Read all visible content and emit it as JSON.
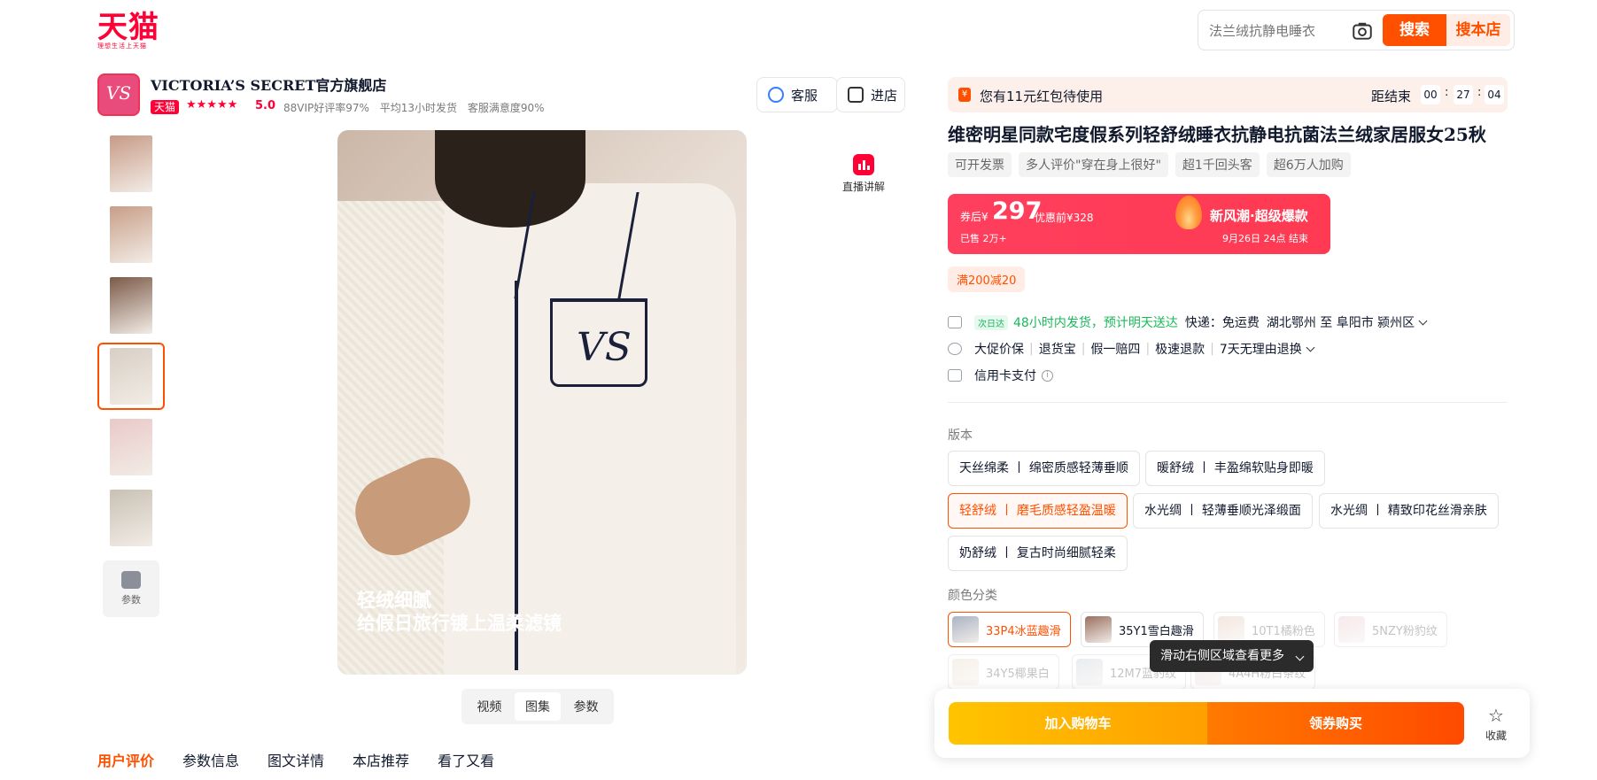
{
  "header": {
    "logo": "天猫",
    "logo_sub": "理想生活上天猫",
    "search_placeholder": "法兰绒抗静电睡衣",
    "search_button": "搜索",
    "search_store_button": "搜本店"
  },
  "shop": {
    "logo_text": "VS",
    "name": "VICTORIA’S SECRET官方旗舰店",
    "badge": "天猫",
    "stars": "★★★★★",
    "rating": "5.0",
    "stats": [
      "88VIP好评率97%",
      "平均13小时发货",
      "客服满意度90%"
    ],
    "service_button": "客服",
    "enter_button": "进店"
  },
  "gallery": {
    "caption_line1": "轻绒细腻",
    "caption_line2": "给假日旅行镀上温柔滤镜",
    "live_explain": "直播讲解",
    "params_thumb": "参数",
    "view_tabs": [
      "视频",
      "图集",
      "参数"
    ],
    "active_tab": "图集",
    "thumb_colors": [
      "#c79a86",
      "#c89e88",
      "#7b5a48",
      "#d8cfc4",
      "#e9c9c8",
      "#c9c1b4"
    ],
    "active_thumb_index": 3
  },
  "bottom_nav": [
    "用户评价",
    "参数信息",
    "图文详情",
    "本店推荐",
    "看了又看"
  ],
  "product": {
    "red_packet": "您有11元红包待使用",
    "countdown_label": "距结束",
    "countdown": [
      "00",
      "27",
      "04"
    ],
    "title": "维密明星同款宅度假系列轻舒绒睡衣抗静电抗菌法兰绒家居服女25秋",
    "tags": [
      "可开发票",
      "多人评价\"穿在身上很好\"",
      "超1千回头客",
      "超6万人加购"
    ],
    "price_prefix": "券后¥",
    "price": "297",
    "price_orig": "优惠前¥328",
    "sold": "已售  2万+",
    "promo_title": "新风潮·超级爆款",
    "promo_date": "9月26日  24点  结束",
    "coupon": "满200减20"
  },
  "delivery": {
    "next_day": "次日达",
    "ship_time": "48小时内发货，预计明天送达",
    "express": "快递：免运费",
    "route": "湖北鄂州  至  阜阳市  颍州区",
    "guarantees": [
      "大促价保",
      "退货宝",
      "假一赔四",
      "极速退款",
      "7天无理由退换"
    ],
    "payment": "信用卡支付"
  },
  "version": {
    "label": "版本",
    "options": [
      "天丝绵柔 丨 绵密质感轻薄垂顺",
      "暖舒绒 丨 丰盈绵软贴身即暖",
      "轻舒绒 丨 磨毛质感轻盈温暖",
      "水光绸 丨 轻薄垂顺光泽缎面",
      "水光绸 丨 精致印花丝滑亲肤",
      "奶舒绒 丨 复古时尚细腻轻柔"
    ],
    "selected_index": 2
  },
  "colors": {
    "label": "颜色分类",
    "options": [
      "33P4冰蓝趣滑",
      "35Y1雪白趣滑",
      "10T1橘粉色",
      "5NZY粉豹纹",
      "34Y5椰果白",
      "12M7蓝豹纹",
      "4A4H粉白条纹"
    ],
    "swatches": [
      "#aab4c4",
      "#9a7060",
      "#e0b8a8",
      "#e8c0c8",
      "#e8d4c4",
      "#c0c8d4",
      "#e8c8cc"
    ],
    "selected_index": 0
  },
  "tooltip": "滑动右侧区域查看更多",
  "buy": {
    "add_cart": "加入购物车",
    "buy_now": "领券购买",
    "favorite": "收藏"
  }
}
